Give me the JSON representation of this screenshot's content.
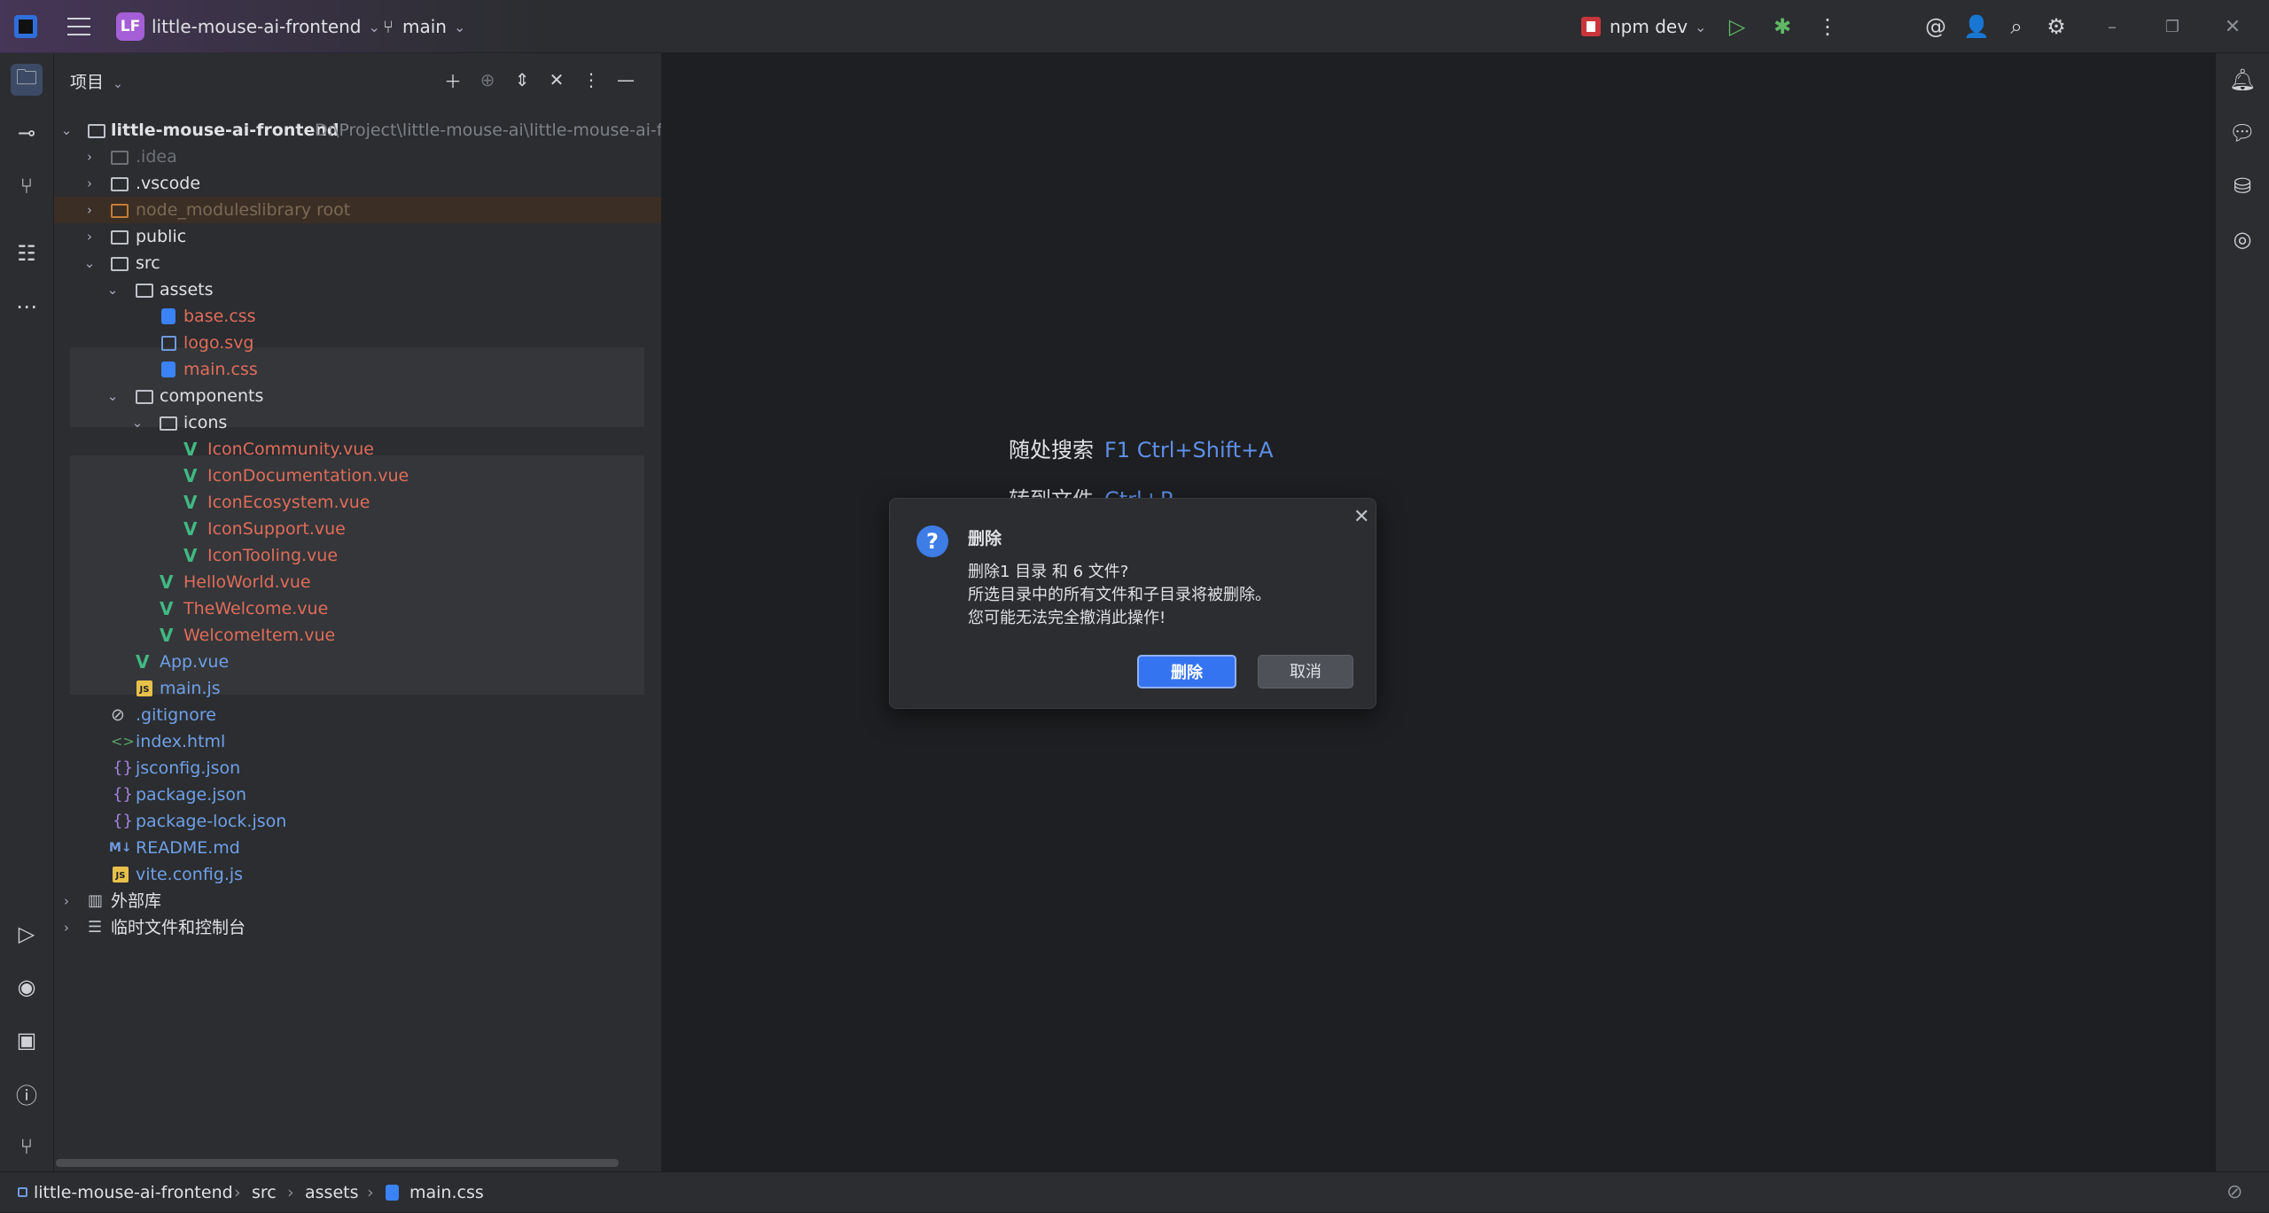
{
  "topbar": {
    "project_badge": "LF",
    "project_name": "little-mouse-ai-frontend",
    "branch": "main",
    "run_config": "npm dev"
  },
  "panel": {
    "title": "项目"
  },
  "tree": {
    "root": {
      "name": "little-mouse-ai-frontend",
      "path": "D:\\Project\\little-mouse-ai\\little-mouse-ai-frontend"
    },
    "idea": ".idea",
    "vscode": ".vscode",
    "node_modules": "node_modules",
    "node_modules_tag": "library root",
    "public": "public",
    "src": "src",
    "assets": "assets",
    "base_css": "base.css",
    "logo_svg": "logo.svg",
    "main_css": "main.css",
    "components": "components",
    "icons": "icons",
    "icon_community": "IconCommunity.vue",
    "icon_documentation": "IconDocumentation.vue",
    "icon_ecosystem": "IconEcosystem.vue",
    "icon_support": "IconSupport.vue",
    "icon_tooling": "IconTooling.vue",
    "hello_world": "HelloWorld.vue",
    "the_welcome": "TheWelcome.vue",
    "welcome_item": "WelcomeItem.vue",
    "app_vue": "App.vue",
    "main_js": "main.js",
    "gitignore": ".gitignore",
    "index_html": "index.html",
    "jsconfig": "jsconfig.json",
    "package_json": "package.json",
    "package_lock": "package-lock.json",
    "readme": "README.md",
    "vite_config": "vite.config.js",
    "external_libs": "外部库",
    "scratches": "临时文件和控制台"
  },
  "editor": {
    "hint1_label": "随处搜索",
    "hint1_keys": "F1 Ctrl+Shift+A",
    "hint2_label": "转到文件",
    "hint2_keys": "Ctrl+P"
  },
  "dialog": {
    "title": "删除",
    "line1": "删除1 目录 和 6 文件?",
    "line2": "所选目录中的所有文件和子目录将被删除。",
    "line3": "您可能无法完全撤消此操作!",
    "confirm": "删除",
    "cancel": "取消"
  },
  "statusbar": {
    "crumb1": "little-mouse-ai-frontend",
    "crumb2": "src",
    "crumb3": "assets",
    "crumb4": "main.css"
  }
}
